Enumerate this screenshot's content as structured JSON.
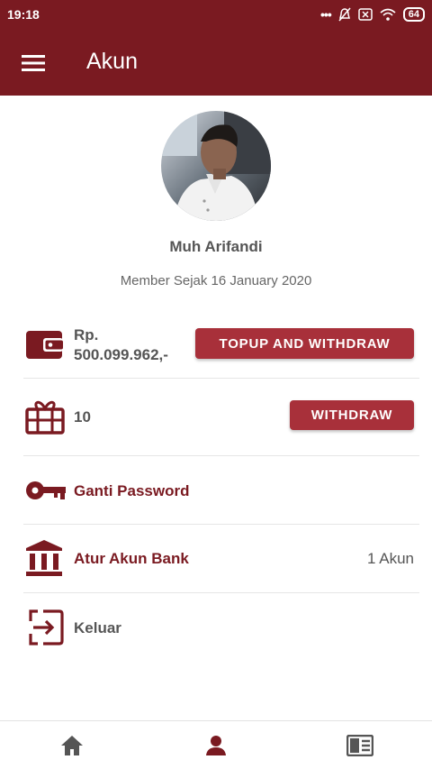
{
  "status_bar": {
    "time": "19:18",
    "battery": "64"
  },
  "header": {
    "title": "Akun"
  },
  "profile": {
    "name": "Muh Arifandi",
    "member_since": "Member Sejak 16 January 2020"
  },
  "balance": {
    "currency": "Rp.",
    "amount": "500.099.962,-",
    "button_label": "TOPUP AND WITHDRAW"
  },
  "points": {
    "value": "10",
    "button_label": "WITHDRAW"
  },
  "menu": {
    "change_password": "Ganti Password",
    "bank_account": "Atur Akun Bank",
    "bank_count": "1 Akun",
    "logout": "Keluar"
  },
  "colors": {
    "primary": "#7a1a21",
    "button": "#a8303a",
    "icon_gray": "#555555"
  },
  "icons": [
    "menu-icon",
    "wallet-icon",
    "gift-icon",
    "key-icon",
    "bank-icon",
    "logout-icon",
    "home-icon",
    "person-icon",
    "news-icon"
  ]
}
